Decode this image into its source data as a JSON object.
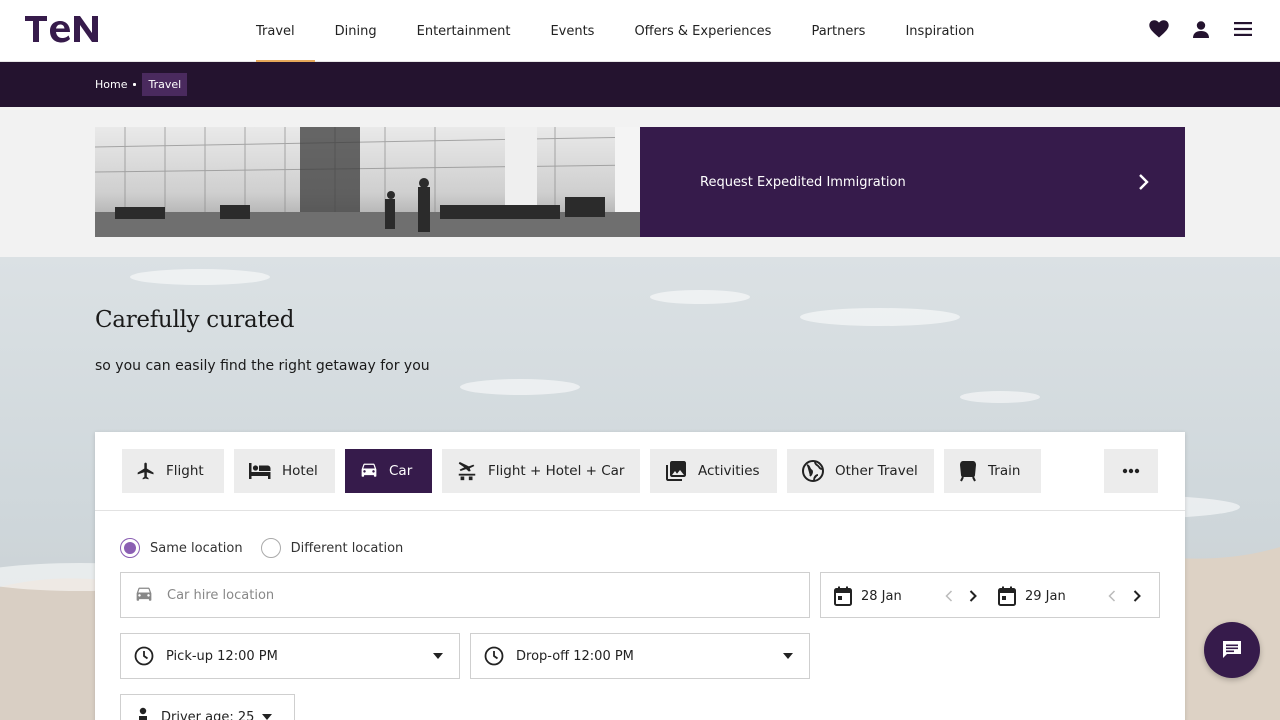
{
  "brand": {
    "logo_text": "TEN",
    "accent": "#361b4b",
    "dark": "#24132f",
    "underline": "#e6a85a"
  },
  "nav": {
    "items": [
      {
        "label": "Travel",
        "active": true
      },
      {
        "label": "Dining"
      },
      {
        "label": "Entertainment"
      },
      {
        "label": "Events"
      },
      {
        "label": "Offers & Experiences"
      },
      {
        "label": "Partners"
      },
      {
        "label": "Inspiration"
      }
    ],
    "icons": [
      "heart-icon",
      "user-icon",
      "menu-icon"
    ]
  },
  "breadcrumb": {
    "home": "Home",
    "current": "Travel"
  },
  "banner": {
    "cta_label": "Request Expedited Immigration",
    "icon": "chevron-right-icon"
  },
  "hero": {
    "headline": "Carefully curated",
    "subline": "so you can easily find the right getaway for you"
  },
  "search": {
    "tabs": [
      {
        "label": "Flight",
        "icon": "plane-icon"
      },
      {
        "label": "Hotel",
        "icon": "bed-icon"
      },
      {
        "label": "Car",
        "icon": "car-icon",
        "active": true
      },
      {
        "label": "Flight + Hotel + Car",
        "icon": "package-icon"
      },
      {
        "label": "Activities",
        "icon": "photos-icon"
      },
      {
        "label": "Other Travel",
        "icon": "globe-icon"
      },
      {
        "label": "Train",
        "icon": "train-icon"
      }
    ],
    "more_icon": "more-horizontal-icon",
    "location_mode": {
      "same_label": "Same location",
      "different_label": "Different location",
      "selected": "same"
    },
    "location": {
      "placeholder": "Car hire location",
      "value": ""
    },
    "dates": {
      "pickup_date": "28 Jan",
      "dropoff_date": "29 Jan"
    },
    "pickup_time": "Pick-up 12:00 PM",
    "dropoff_time": "Drop-off 12:00 PM",
    "driver_age": "Driver age: 25"
  },
  "chat": {
    "icon": "chat-icon"
  }
}
